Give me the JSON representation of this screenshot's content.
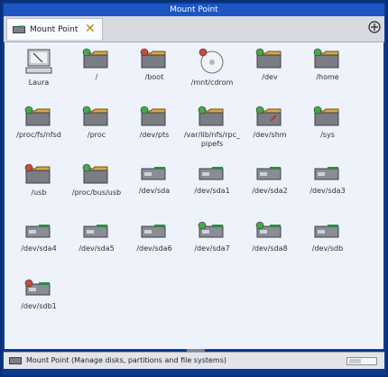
{
  "window": {
    "title": "Mount Point"
  },
  "tabs": [
    {
      "label": "Mount Point"
    }
  ],
  "items": [
    {
      "label": "Laura",
      "type": "computer",
      "status": "none"
    },
    {
      "label": "/",
      "type": "folder",
      "status": "green"
    },
    {
      "label": "/boot",
      "type": "folder",
      "status": "red"
    },
    {
      "label": "/mnt/cdrom",
      "type": "cdrom",
      "status": "red"
    },
    {
      "label": "/dev",
      "type": "folder",
      "status": "green"
    },
    {
      "label": "/home",
      "type": "folder",
      "status": "green"
    },
    {
      "label": "/proc/fs/nfsd",
      "type": "folder",
      "status": "green"
    },
    {
      "label": "/proc",
      "type": "folder",
      "status": "green"
    },
    {
      "label": "/dev/pts",
      "type": "folder",
      "status": "green"
    },
    {
      "label": "/var/lib/nfs/rpc_pipefs",
      "type": "folder",
      "status": "green"
    },
    {
      "label": "/dev/shm",
      "type": "folder-special",
      "status": "green"
    },
    {
      "label": "/sys",
      "type": "folder",
      "status": "green"
    },
    {
      "label": "/usb",
      "type": "folder",
      "status": "red"
    },
    {
      "label": "/proc/bus/usb",
      "type": "folder",
      "status": "green"
    },
    {
      "label": "/dev/sda",
      "type": "drive",
      "status": "none"
    },
    {
      "label": "/dev/sda1",
      "type": "drive",
      "status": "none"
    },
    {
      "label": "/dev/sda2",
      "type": "drive",
      "status": "none"
    },
    {
      "label": "/dev/sda3",
      "type": "drive",
      "status": "none"
    },
    {
      "label": "/dev/sda4",
      "type": "drive",
      "status": "none"
    },
    {
      "label": "/dev/sda5",
      "type": "drive",
      "status": "none"
    },
    {
      "label": "/dev/sda6",
      "type": "drive",
      "status": "none"
    },
    {
      "label": "/dev/sda7",
      "type": "drive",
      "status": "green"
    },
    {
      "label": "/dev/sda8",
      "type": "drive",
      "status": "green"
    },
    {
      "label": "/dev/sdb",
      "type": "drive",
      "status": "none"
    },
    {
      "label": "/dev/sdb1",
      "type": "drive",
      "status": "red"
    }
  ],
  "status": {
    "text": "Mount Point (Manage disks, partitions and file systems)"
  },
  "colors": {
    "titlebar": "#1d56c2",
    "content": "#eef3fb",
    "green_status": "#46a84a",
    "red_status": "#c74c3c",
    "drive_accent": "#2e8a44"
  }
}
